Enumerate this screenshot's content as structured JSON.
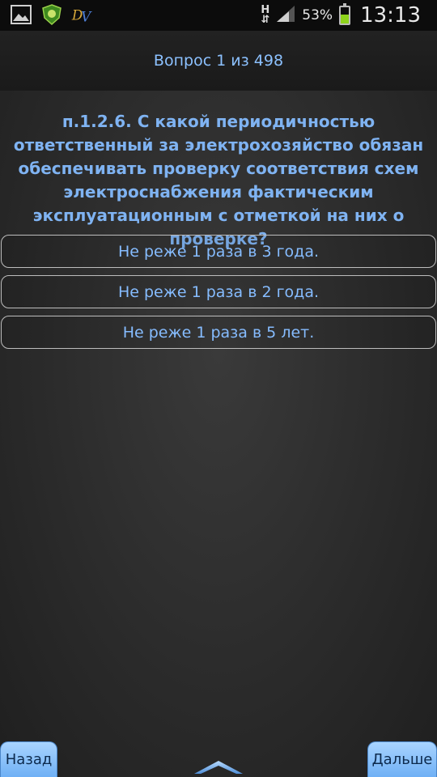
{
  "status_bar": {
    "notification_icons": [
      "gallery-icon",
      "app-shield-icon",
      "app-logo-icon"
    ],
    "network_label": "H",
    "battery_percent": "53%",
    "battery_level": 0.53,
    "time": "13:13"
  },
  "header": {
    "title": "Вопрос 1 из 498"
  },
  "question": {
    "text": "п.1.2.6. С какой периодичностью ответственный за электрохозяйство обязан обеспечивать проверку соответствия схем электроснабжения фактическим эксплуатационным с отметкой на них о проверке?"
  },
  "answers": [
    {
      "label": "Не реже 1 раза в 3 года."
    },
    {
      "label": "Не реже 1 раза в 2 года."
    },
    {
      "label": "Не реже 1 раза в 5 лет."
    }
  ],
  "nav": {
    "back_label": "Назад",
    "next_label": "Дальше",
    "expand_icon": "chevron-up-icon"
  },
  "colors": {
    "accent_text": "#7fb8ff",
    "button_fill": "#8cc3fb",
    "battery_green": "#8ed31b"
  }
}
